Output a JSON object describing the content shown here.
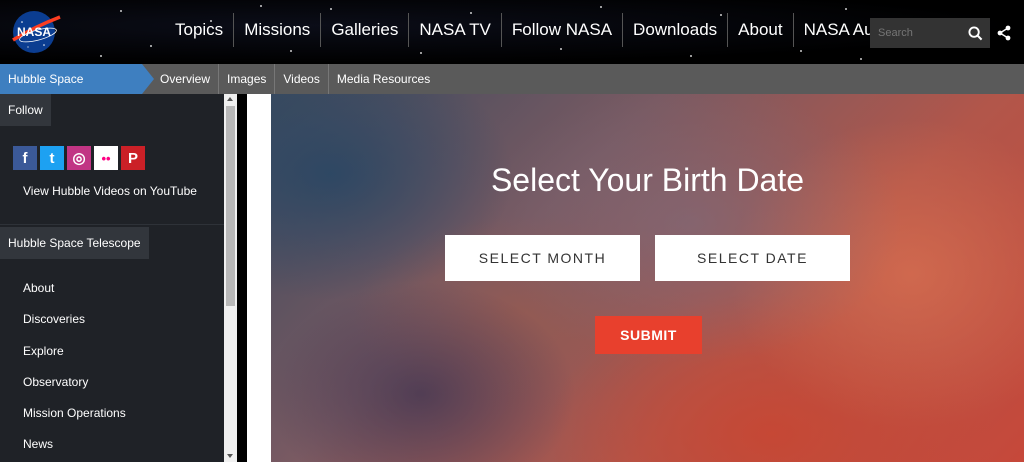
{
  "header": {
    "logo_text": "NASA",
    "nav": [
      "Topics",
      "Missions",
      "Galleries",
      "NASA TV",
      "Follow NASA",
      "Downloads",
      "About",
      "NASA Audiences"
    ],
    "search_placeholder": "Search"
  },
  "subnav": {
    "home": "Hubble Space Telescope",
    "items": [
      "Overview",
      "Images",
      "Videos",
      "Media Resources"
    ]
  },
  "sidebar": {
    "follow_heading": "Follow",
    "social": [
      {
        "icon": "facebook-icon",
        "glyph": "f",
        "color": "#3b5998"
      },
      {
        "icon": "twitter-icon",
        "glyph": "t",
        "color": "#1da1f2"
      },
      {
        "icon": "instagram-icon",
        "glyph": "◎",
        "color": "#c13584"
      },
      {
        "icon": "flickr-icon",
        "glyph": "••",
        "color": "#ffffff"
      },
      {
        "icon": "pinterest-icon",
        "glyph": "P",
        "color": "#cb2027"
      }
    ],
    "youtube_link": "View Hubble Videos on YouTube",
    "section_heading": "Hubble Space Telescope",
    "menu": [
      "About",
      "Discoveries",
      "Explore",
      "Observatory",
      "Mission Operations",
      "News"
    ]
  },
  "hero": {
    "title": "Select Your Birth Date",
    "month_button": "SELECT MONTH",
    "date_button": "SELECT DATE",
    "submit_button": "SUBMIT"
  },
  "colors": {
    "subnav_home": "#3e7fc0",
    "submit": "#e8402d",
    "sidebar_bg": "#1f2227"
  }
}
